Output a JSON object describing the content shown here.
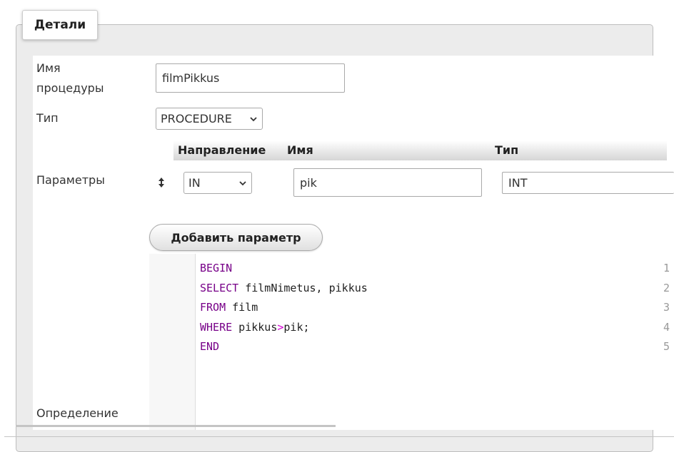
{
  "details": {
    "legend": "Детали"
  },
  "form": {
    "name_label_line1": "Имя",
    "name_label_line2": "процедуры",
    "name_value": "filmPikkus",
    "type_label": "Тип",
    "type_value": "PROCEDURE",
    "params_label": "Параметры",
    "definition_label": "Определение"
  },
  "params": {
    "headers": {
      "direction": "Направление",
      "name": "Имя",
      "type": "Тип"
    },
    "rows": [
      {
        "direction": "IN",
        "name": "pik",
        "type": "INT"
      }
    ],
    "add_button_label": "Добавить параметр"
  },
  "editor": {
    "line_numbers": [
      "1",
      "2",
      "3",
      "4",
      "5"
    ],
    "lines": [
      {
        "kw": "BEGIN",
        "rest": ""
      },
      {
        "kw": "SELECT",
        "rest": " filmNimetus, pikkus"
      },
      {
        "kw": "FROM",
        "rest": " film"
      },
      {
        "kw": "WHERE",
        "rest_a": " pikkus",
        "op": ">",
        "rest_b": "pik;"
      },
      {
        "kw": "END",
        "rest": ""
      }
    ]
  },
  "icons": {
    "sort": "sort-updown-icon",
    "chevron": "chevron-down-icon"
  },
  "colors": {
    "keyword": "#770088",
    "operator": "#d400d4",
    "fieldset_bg": "#ececec"
  }
}
